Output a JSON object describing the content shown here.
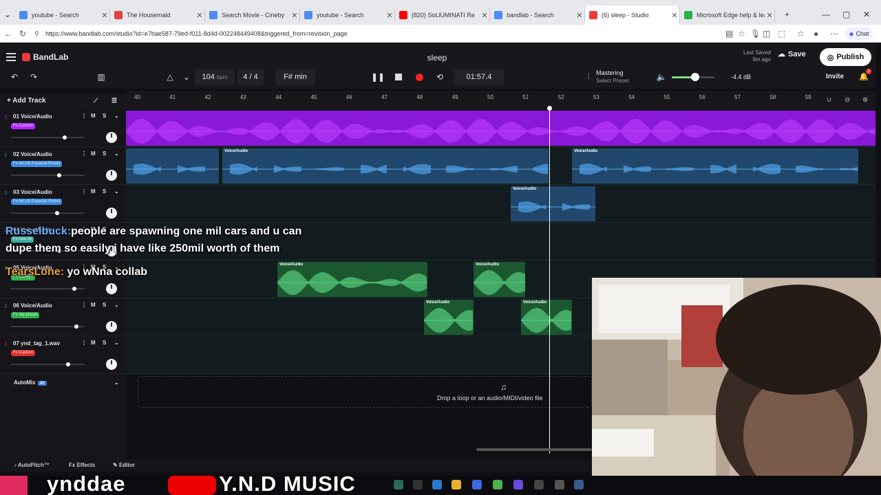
{
  "browser": {
    "tabs": [
      {
        "title": "youtube - Search",
        "color": "#4b8cf5"
      },
      {
        "title": "The Housemaid",
        "color": "#e04040"
      },
      {
        "title": "Search Movie - Cineby",
        "color": "#4b8cf5"
      },
      {
        "title": "youtube - Search",
        "color": "#4b8cf5"
      },
      {
        "title": "(820) SoLlUMINATI Re",
        "color": "#ff0000"
      },
      {
        "title": "bandlab - Search",
        "color": "#4b8cf5"
      },
      {
        "title": "(6) sleep - Studio",
        "color": "#f03a3a"
      },
      {
        "title": "Microsoft Edge help & learn",
        "color": "#2bb34a"
      }
    ],
    "url": "https://www.bandlab.com/studio?id=e7bae587-79ed-f011-8d4d-002248449408&triggered_from=revision_page",
    "copilot_label": "Chat"
  },
  "app": {
    "brand": "BandLab",
    "song_title": "sleep",
    "last_saved_label": "Last Saved",
    "last_saved_time": "9m ago",
    "save_label": "Save",
    "publish_label": "Publish",
    "invite_label": "Invite",
    "notification_count": "1"
  },
  "transport": {
    "tempo": "104",
    "tempo_unit": "bpm",
    "time_sig_num": "4",
    "time_sig_den": "4",
    "key": "F# min",
    "time": "01:57.4",
    "mastering_label": "Mastering",
    "mastering_preset": "Select Preset",
    "master_volume_db": "-4.4 dB",
    "master_volume_level": 0.55
  },
  "panel": {
    "add_track_label": "Add Track",
    "automix_label": "AutoMix",
    "automix_badge": "AI",
    "drop_text": "Drop a loop or an audio/MIDI/video file"
  },
  "ruler": [
    "40",
    "41",
    "42",
    "43",
    "44",
    "45",
    "46",
    "47",
    "48",
    "49",
    "50",
    "51",
    "52",
    "53",
    "54",
    "55",
    "56",
    "57",
    "58",
    "59"
  ],
  "tracks": [
    {
      "num": "01",
      "name": "Voice/Audio",
      "fx": "Fx Custom",
      "color": "#b026ff",
      "fx_color": "#b026ff",
      "arrow_color": "#b026ff",
      "fader": 0.78
    },
    {
      "num": "02",
      "name": "Voice/Audio",
      "fx": "Fx Ad Lib Espacial Preset",
      "color": "#3a8ce0",
      "fx_color": "#3a8ce0",
      "arrow_color": "#3a8ce0",
      "fader": 0.7
    },
    {
      "num": "03",
      "name": "Voice/Audio",
      "fx": "Fx Ad Lib Espacial Preset",
      "color": "#3a8ce0",
      "fx_color": "#3a8ce0",
      "arrow_color": "#3a8ce0",
      "fader": 0.67
    },
    {
      "num": "04",
      "name": "Voice/Audio",
      "fx": "Fx new lib",
      "color": "#3ab0a0",
      "fx_color": "#3ab0a0",
      "arrow_color": "#3ab0a0",
      "fader": 0.7
    },
    {
      "num": "05",
      "name": "Voice/Audio",
      "fx": "Fx Custom",
      "color": "#2bb34a",
      "fx_color": "#2bb34a",
      "arrow_color": "#2bb34a",
      "fader": 0.92
    },
    {
      "num": "06",
      "name": "Voice/Audio",
      "fx": "Fx rap preset",
      "color": "#2bb34a",
      "fx_color": "#2bb34a",
      "arrow_color": "#2bb34a",
      "fader": 0.95
    },
    {
      "num": "07",
      "name": "ynd_tag_1.wav",
      "fx": "Fx Custom",
      "color": "#e03030",
      "fx_color": "#e03030",
      "arrow_color": "#e03030",
      "fader": 0.83
    }
  ],
  "mute_label": "M",
  "solo_label": "S",
  "clip_label": "Voice/Audio",
  "bottom": {
    "autopitch": "AutoPitch™",
    "effects": "Effects",
    "editor": "Editor"
  },
  "chat": [
    {
      "user": "Russelbuck:",
      "text": "people are spawning one mil cars and u can"
    },
    {
      "text": "dupe them so easily i have like 250mil worth of them"
    },
    {
      "user": "TearsLone:",
      "text": "yo wNna collab"
    }
  ],
  "overlay": {
    "tiktok_handle": "ynddae",
    "youtube_handle": "Y.N.D MUSIC"
  }
}
